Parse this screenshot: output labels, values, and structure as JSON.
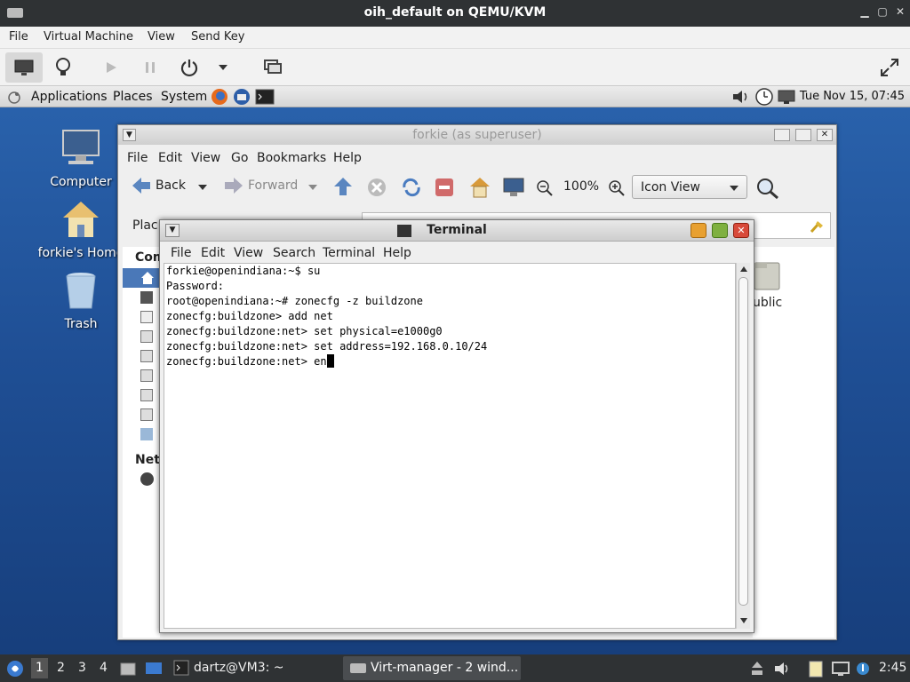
{
  "host": {
    "title": "oih_default on QEMU/KVM",
    "menu": [
      "File",
      "Virtual Machine",
      "View",
      "Send Key"
    ]
  },
  "guest_panel": {
    "menus": [
      "Applications",
      "Places",
      "System"
    ],
    "clock": "Tue Nov 15, 07:45"
  },
  "desktop_icons": [
    "Computer",
    "forkie's Home",
    "Trash"
  ],
  "nautilus": {
    "title": "forkie (as superuser)",
    "menu": [
      "File",
      "Edit",
      "View",
      "Go",
      "Bookmarks",
      "Help"
    ],
    "back_label": "Back",
    "forward_label": "Forward",
    "zoom": "100%",
    "view_mode": "Icon View",
    "places_label": "Plac",
    "side_heading_1": "Com",
    "side_heading_2": "Net",
    "public_label": "ublic"
  },
  "terminal": {
    "title": "Terminal",
    "menu": [
      "File",
      "Edit",
      "View",
      "Search",
      "Terminal",
      "Help"
    ],
    "lines": [
      "forkie@openindiana:~$ su",
      "Password:",
      "root@openindiana:~# zonecfg -z buildzone",
      "zonecfg:buildzone> add net",
      "zonecfg:buildzone:net> set physical=e1000g0",
      "zonecfg:buildzone:net> set address=192.168.0.10/24",
      "zonecfg:buildzone:net> en"
    ]
  },
  "taskbar": {
    "workspaces": [
      "1",
      "2",
      "3",
      "4"
    ],
    "terminal_task": "dartz@VM3: ~",
    "virt_task": "Virt-manager - 2 wind...",
    "clock": "2:45"
  },
  "colors": {
    "desktop": "#1f4f95",
    "host_chrome": "#2f3234"
  }
}
